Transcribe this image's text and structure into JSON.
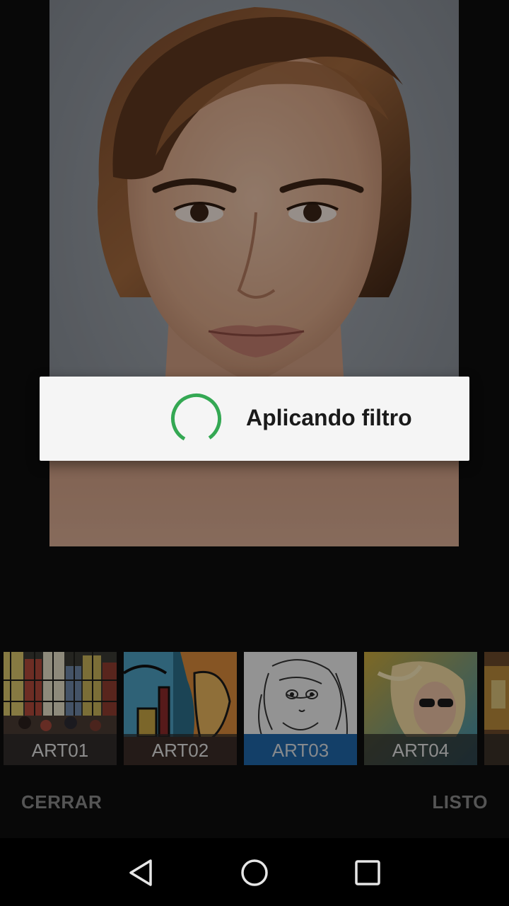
{
  "dialog": {
    "message": "Aplicando filtro",
    "accent": "#34a853"
  },
  "filters": [
    {
      "label": "ART01",
      "selected": false
    },
    {
      "label": "ART02",
      "selected": false
    },
    {
      "label": "ART03",
      "selected": true
    },
    {
      "label": "ART04",
      "selected": false
    }
  ],
  "actions": {
    "close_label": "CERRAR",
    "done_label": "LISTO"
  },
  "navbar": {
    "back_icon": "back-triangle-icon",
    "home_icon": "home-circle-icon",
    "recents_icon": "recents-square-icon"
  },
  "colors": {
    "selected_filter": "#1f67a9",
    "action_text": "#8a8a8a"
  }
}
